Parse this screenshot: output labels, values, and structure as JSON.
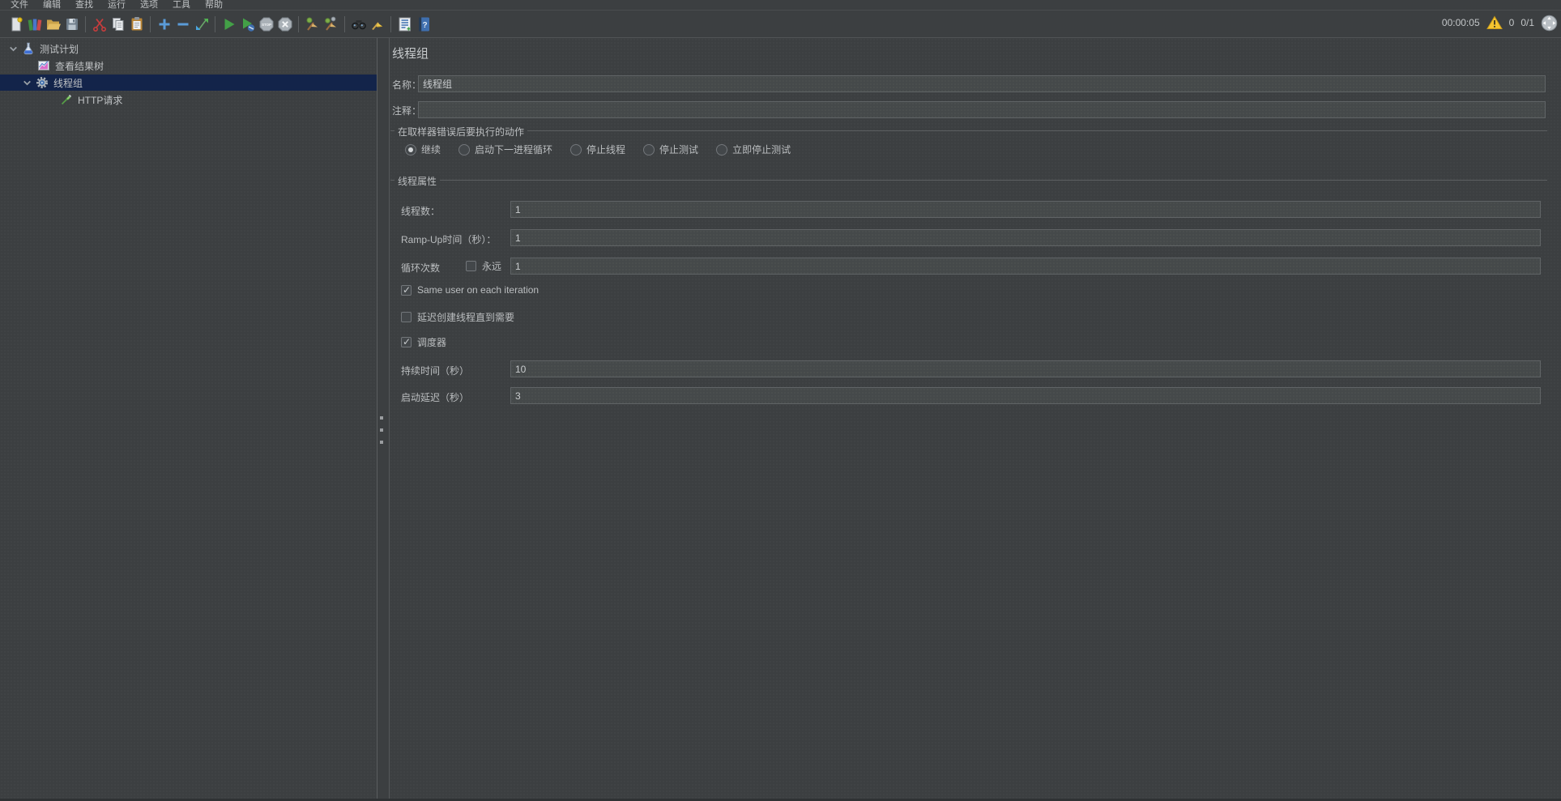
{
  "menu": {
    "items": [
      "文件",
      "编辑",
      "查找",
      "运行",
      "选项",
      "工具",
      "帮助"
    ]
  },
  "toolbar": {
    "icons": [
      "new-file",
      "templates",
      "open-file",
      "save",
      "cut",
      "copy",
      "paste",
      "add-element",
      "remove-element",
      "move-element",
      "start",
      "start-no-timers",
      "stop",
      "shutdown",
      "clear",
      "clear-all",
      "search",
      "search-reset",
      "function-helper",
      "help"
    ]
  },
  "status": {
    "elapsed": "00:00:05",
    "warning_count": "0",
    "active_threads": "0/1"
  },
  "tree": {
    "items": [
      {
        "label": "测试计划",
        "icon": "test-plan",
        "expanded": true,
        "selected": false
      },
      {
        "label": "查看结果树",
        "icon": "results-tree",
        "selected": false
      },
      {
        "label": "线程组",
        "icon": "thread-group",
        "expanded": true,
        "selected": true
      },
      {
        "label": "HTTP请求",
        "icon": "http-request",
        "selected": false
      }
    ]
  },
  "panel": {
    "title": "线程组",
    "name": {
      "label": "名称：",
      "value": "线程组"
    },
    "comments": {
      "label": "注释：",
      "value": ""
    },
    "error_action": {
      "legend": "在取样器错误后要执行的动作",
      "options": [
        {
          "label": "继续",
          "selected": true
        },
        {
          "label": "启动下一进程循环",
          "selected": false
        },
        {
          "label": "停止线程",
          "selected": false
        },
        {
          "label": "停止测试",
          "selected": false
        },
        {
          "label": "立即停止测试",
          "selected": false
        }
      ]
    },
    "thread_properties": {
      "legend": "线程属性",
      "num_threads": {
        "label": "线程数：",
        "value": "1"
      },
      "ramp_up": {
        "label": "Ramp-Up时间（秒）：",
        "value": "1"
      },
      "loop_count": {
        "label": "循环次数",
        "infinite_label": "永远",
        "infinite_checked": false,
        "value": "1"
      },
      "same_user": {
        "label": "Same user on each iteration",
        "checked": true
      },
      "delayed_start": {
        "label": "延迟创建线程直到需要",
        "checked": false
      },
      "scheduler": {
        "label": "调度器",
        "checked": true
      },
      "duration": {
        "label": "持续时间（秒）",
        "value": "10"
      },
      "startup_delay": {
        "label": "启动延迟（秒）",
        "value": "3"
      }
    }
  },
  "colors": {
    "background": "#3c3f41",
    "selection": "#13244a",
    "field_background": "#45494a",
    "accent_green": "#43a047",
    "warning_yellow": "#f4c430"
  }
}
